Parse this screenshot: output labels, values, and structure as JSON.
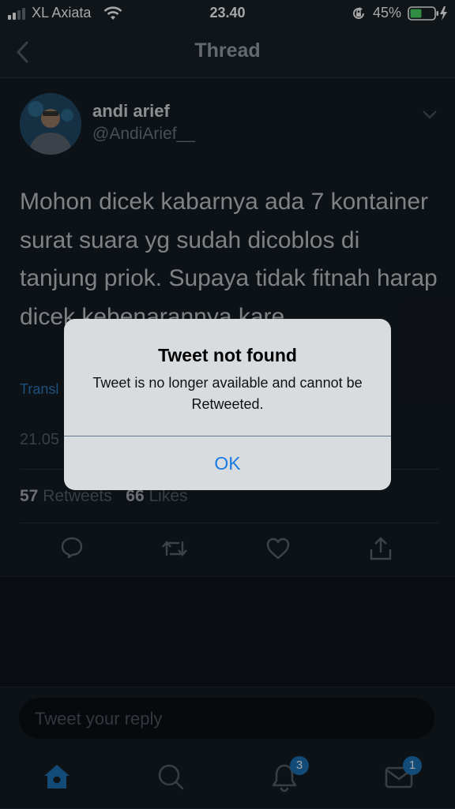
{
  "status_bar": {
    "carrier": "XL Axiata",
    "time": "23.40",
    "battery": "45%"
  },
  "header": {
    "title": "Thread"
  },
  "tweet": {
    "name": "andi arief",
    "handle": "@AndiArief__",
    "text": "Mohon dicek kabarnya ada 7 kontainer surat suara yg sudah dicoblos di tanjung priok. Supaya tidak fitnah harap dicek kebenarannya kare",
    "translate_label": "Transl",
    "timestamp": "21.05",
    "retweets_count": "57",
    "retweets_label": "Retweets",
    "likes_count": "66",
    "likes_label": "Likes"
  },
  "reply": {
    "placeholder": "Tweet your reply"
  },
  "tabbar": {
    "notifications_badge": "3",
    "messages_badge": "1"
  },
  "alert": {
    "title": "Tweet not found",
    "message": "Tweet is no longer available and cannot be Retweeted.",
    "button": "OK"
  },
  "colors": {
    "accent": "#1b7ae0",
    "brand": "#1d74b8",
    "background": "#0f141b"
  }
}
